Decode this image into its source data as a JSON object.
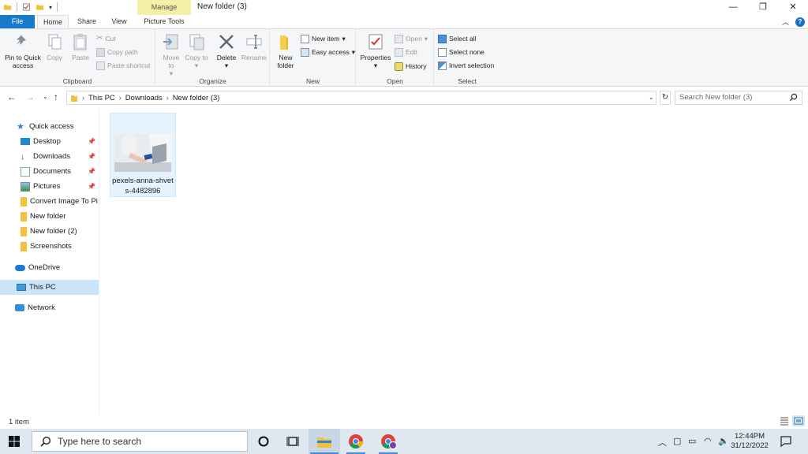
{
  "window": {
    "title": "New folder (3)",
    "contextual_tab_group": "Manage",
    "minimize": "—",
    "restore": "❐",
    "close": "✕"
  },
  "ribbon_tabs": {
    "file": "File",
    "home": "Home",
    "share": "Share",
    "view": "View",
    "picture_tools": "Picture Tools"
  },
  "clipboard": {
    "pin": "Pin to Quick access",
    "copy": "Copy",
    "paste": "Paste",
    "cut": "Cut",
    "copy_path": "Copy path",
    "paste_shortcut": "Paste shortcut",
    "label": "Clipboard"
  },
  "organize": {
    "move_to": "Move to",
    "copy_to": "Copy to",
    "delete": "Delete",
    "rename": "Rename",
    "label": "Organize"
  },
  "new_group": {
    "new_folder": "New folder",
    "new_item": "New item",
    "easy_access": "Easy access",
    "label": "New"
  },
  "open_group": {
    "properties": "Properties",
    "open": "Open",
    "edit": "Edit",
    "history": "History",
    "label": "Open"
  },
  "select_group": {
    "select_all": "Select all",
    "select_none": "Select none",
    "invert_selection": "Invert selection",
    "label": "Select"
  },
  "address": {
    "crumbs": [
      "This PC",
      "Downloads",
      "New folder (3)"
    ],
    "search_placeholder": "Search New folder (3)"
  },
  "nav": {
    "quick_access": "Quick access",
    "desktop": "Desktop",
    "downloads": "Downloads",
    "documents": "Documents",
    "pictures": "Pictures",
    "convert": "Convert Image To Pi",
    "new_folder": "New folder",
    "new_folder_2": "New folder (2)",
    "screenshots": "Screenshots",
    "onedrive": "OneDrive",
    "this_pc": "This PC",
    "network": "Network"
  },
  "files": [
    {
      "name": "pexels-anna-shvets-4482896"
    }
  ],
  "status": {
    "item_count": "1 item"
  },
  "taskbar": {
    "search_placeholder": "Type here to search",
    "time": "12:44PM",
    "date": "31/12/2022"
  },
  "colors": {
    "file_tab": "#1979ca",
    "manage_tab": "#f6f0a6",
    "selection": "#cce4f7",
    "taskbar": "#dfe8f0"
  }
}
